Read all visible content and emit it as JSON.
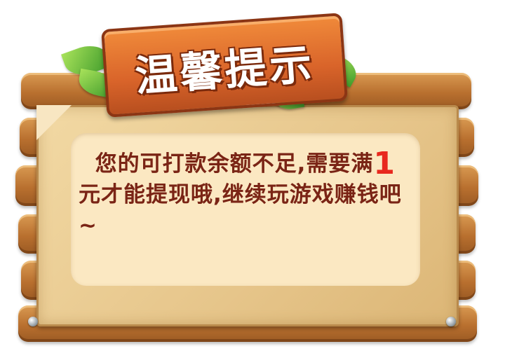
{
  "dialog": {
    "title": "温馨提示",
    "message_part1": "您的可打款余额不足,需要满",
    "amount": "1",
    "message_part2": "元才能提现哦,继续玩游戏赚钱吧~"
  },
  "colors": {
    "wood": "#c07a36",
    "title_board": "#e0692b",
    "paper": "#e9c98e",
    "panel": "#fbe8c2",
    "message_text": "#7a2415",
    "amount_text": "#e8281e"
  },
  "icons": [
    "leaf-icon",
    "nail-icon"
  ]
}
